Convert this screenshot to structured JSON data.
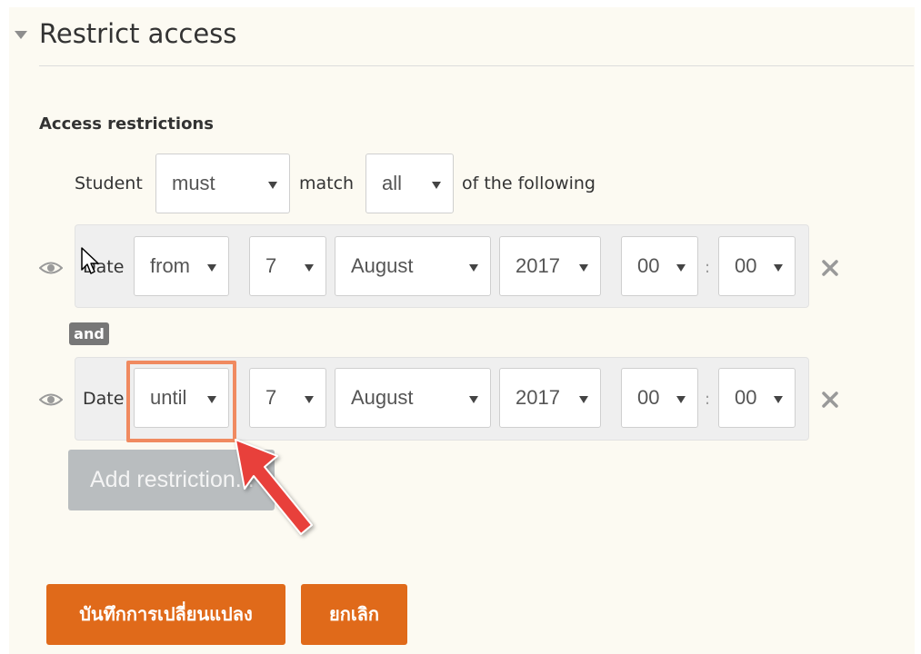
{
  "section": {
    "title": "Restrict access"
  },
  "restrictions": {
    "heading": "Access restrictions",
    "student_label": "Student",
    "must_value": "must",
    "match_label": "match",
    "all_value": "all",
    "following_label": "of the following",
    "join_badge": "and",
    "add_button": "Add restriction..."
  },
  "conditions": [
    {
      "label": "Date",
      "direction": "from",
      "day": "7",
      "month": "August",
      "year": "2017",
      "hour": "00",
      "minute": "00",
      "separator": ":"
    },
    {
      "label": "Date",
      "direction": "until",
      "day": "7",
      "month": "August",
      "year": "2017",
      "hour": "00",
      "minute": "00",
      "separator": ":"
    }
  ],
  "footer": {
    "save_button": "บันทึกการเปลี่ยนแปลง",
    "cancel_button": "ยกเลิก"
  },
  "icons": {
    "toggle": "triangle-down-icon",
    "visibility": "eye-icon",
    "delete": "close-x-icon",
    "pointer": "arrow-cursor-icon",
    "annotation": "red-arrow-icon"
  },
  "colors": {
    "primary": "#e06a1a",
    "highlight": "#f08a60",
    "annotation_arrow": "#e8403a",
    "panel_bg": "#fcfaf2",
    "disabled_button": "#b9bdbf"
  }
}
